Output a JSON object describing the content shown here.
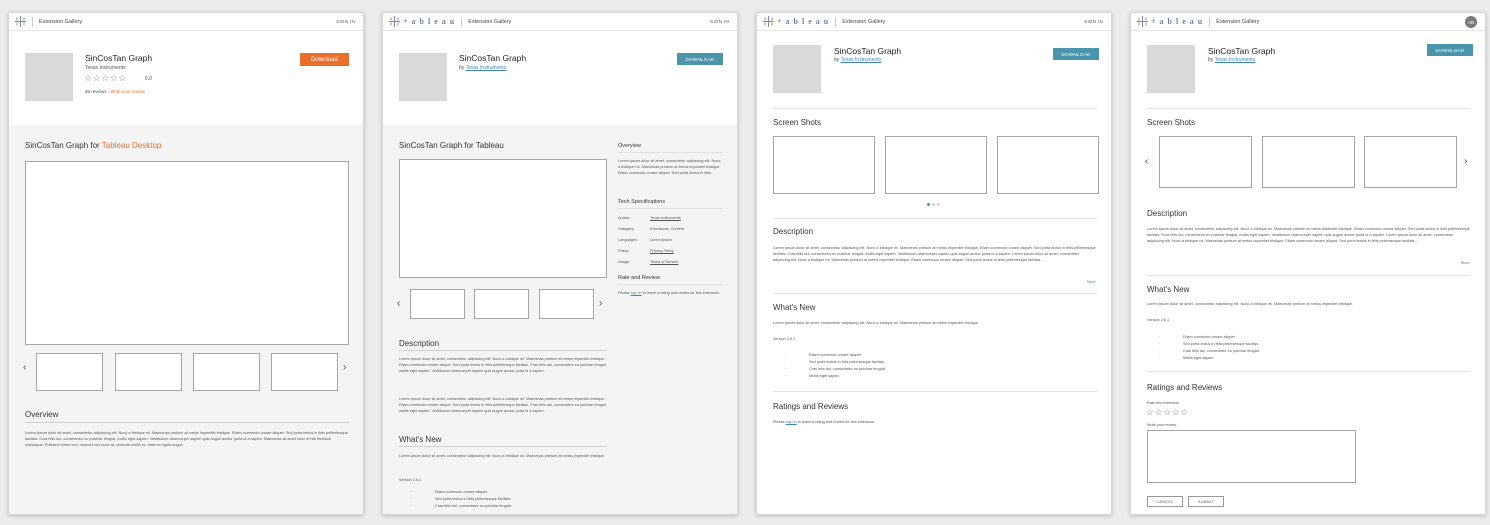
{
  "colors": {
    "accent_orange": "#ea6f2b",
    "accent_teal": "#4a95ac",
    "link": "#3f86b3"
  },
  "header": {
    "wordmark": "+ a b l e a u",
    "gallery": "Extension Gallery",
    "signin": "SIGN IN",
    "avatar_initials": "AB"
  },
  "app": {
    "title": "SinCosTan Graph",
    "by_prefix": "by",
    "publisher": "Texas Instruments",
    "download_label": "Download",
    "download_caps": "DOWNLOAD",
    "stars": "☆☆☆☆☆",
    "rating": "5.0",
    "reviews": "98 reviews",
    "write_review": "Write your review"
  },
  "lorem": {
    "short": "Lorem ipsum dolor sit amet, consectetur adipiscing elit. Nunc a tristique mi. Maecenas pretium at metus imperdiet tristique.",
    "overview1": "Lorem ipsum dolor sit amet, consectetur adipiscing elit. Nunc a tristique mi. Maecenas pretium at metus imperdiet tristique. Etiam commodo ornare aliquet. Sed porta lectus in felis pellentesque facilisis. Cras felis dui, consectetur eu pulvinar feugiat, mollis eget sapien. Vestibulum ullamcorper sapien quis augue auctor porta id a sapien. Maecenas sit amet nunc et nisi tincidunt consequat. Praesent lorem orci, rhoncus nec nunc at, vehicula mollis ex. Nam eu ligula augue.",
    "overview2": "Lorem ipsum dolor sit amet, consectetur adipiscing elit. Nunc a tristique mi. Maecenas pretium at metus imperdiet tristique. Etiam commodo ornare aliquet. Sed porta lectus in felis.",
    "desc_a": "Lorem ipsum dolor sit amet, consectetur adipiscing elit. Nunc a tristique mi. Maecenas pretium at metus imperdiet tristique. Etiam commodo ornare aliquet. Sed porta lectus in felis pellentesque facilisis. Cras felis dui, consectetur eu pulvinar feugiat, mollis eget sapien. Vestibulum ullamcorper sapien quis augue auctor porta id a sapien.",
    "desc_b": "Lorem ipsum dolor sit amet, consectetur adipiscing elit. Nunc a tristique mi. Maecenas pretium at metus imperdiet tristique. Etiam commodo ornare aliquet. Sed porta lectus in felis pellentesque facilisis. Cras felis dui, consectetur eu pulvinar feugiat, mollis eget sapien. Vestibulum ullamcorper sapien quis augue auctor porta id a sapien. Lorem ipsum dolor sit amet, consectetur adipiscing elit. Nunc a tristique mi. Maecenas pretium at metus imperdiet tristique. Etiam commodo ornare aliquet. Sed porta lectus in felis pellentesque facilisis ..."
  },
  "sections": {
    "for_prefix": "SinCosTan Graph for",
    "desktop": "Tableau Desktop",
    "for_tableau": "SinCosTan Graph for Tableau",
    "overview": "Overview",
    "tech_specs": "Tech Specifications",
    "rate_review": "Rate and Review",
    "description": "Description",
    "whats_new": "What's New",
    "screen_shots": "Screen Shots",
    "ratings_reviews": "Ratings and Reviews",
    "version": "Version 2.6.1",
    "more": "More",
    "please": "Please",
    "sign_in": "sign in",
    "to_leave": "to leave a rating and review for this extension.",
    "rate_ext": "Rate this extension",
    "write_your_review": "Write your review",
    "cancel": "CANCEL",
    "submit": "SUBMIT"
  },
  "whats_new_items": [
    "Etiam commodo ornare aliquet.",
    "Sed porta lectus in felis pellentesque facilisis.",
    "Cras felis dui, consectetur eu pulvinar feugiat.",
    "Mollis eget sapien."
  ],
  "specs": [
    {
      "k": "Author:",
      "v": "Texas Instruments",
      "link": true
    },
    {
      "k": "Category:",
      "v": "Extensions, Content",
      "link": false
    },
    {
      "k": "Languages:",
      "v": "Lorem ipsum",
      "link": false
    },
    {
      "k": "Policy:",
      "v": "Privacy Policy",
      "link": true
    },
    {
      "k": "Usage:",
      "v": "Terms of Service",
      "link": true
    }
  ]
}
